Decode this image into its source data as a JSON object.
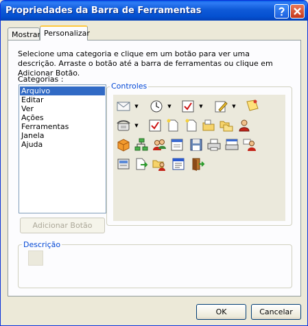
{
  "window": {
    "title": "Propriedades da Barra de Ferramentas"
  },
  "tabs": [
    {
      "label": "Mostrar",
      "active": false
    },
    {
      "label": "Personalizar",
      "active": true
    }
  ],
  "instructions": "Selecione uma categoria e clique em um botão para ver uma descrição. Arraste o botão até a barra de ferramentas ou clique em Adicionar Botão.",
  "categories": {
    "label": "Categorias :",
    "items": [
      "Arquivo",
      "Editar",
      "Ver",
      "Ações",
      "Ferramentas",
      "Janela",
      "Ajuda"
    ],
    "selected": "Arquivo"
  },
  "add_button": {
    "label": "Adicionar Botão",
    "enabled": false
  },
  "controls": {
    "label": "Controles",
    "icons": [
      "envelope-icon",
      "clock-icon",
      "checkmark-page-icon",
      "pencil-page-icon",
      "note-pin-icon",
      "telephone-icon",
      "checklist-icon",
      "new-page-icon",
      "new-page-star-icon",
      "new-folder-icon",
      "copy-folders-icon",
      "person-red-icon",
      "cube-icon",
      "network-icon",
      "group-people-icon",
      "form-page-icon",
      "floppy-disk-icon",
      "printer-icon",
      "printer-preview-icon",
      "person-mail-icon",
      "export-icon",
      "page-arrow-icon",
      "folder-person-icon",
      "window-list-icon",
      "exit-door-icon"
    ]
  },
  "description": {
    "label": "Descrição"
  },
  "footer": {
    "ok_label": "OK",
    "cancel_label": "Cancelar"
  },
  "colors": {
    "title_bar": "#0450d0",
    "selection": "#316ac5",
    "group_title": "#0046d5",
    "tab_highlight": "#ffc83c"
  }
}
